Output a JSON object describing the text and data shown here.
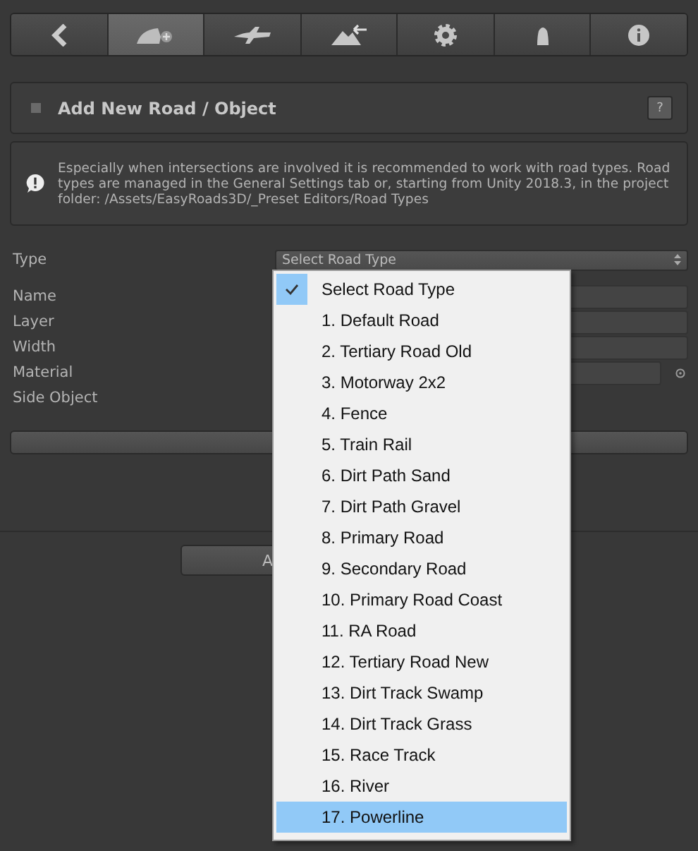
{
  "toolbar": {
    "tabs": [
      {
        "selected": false
      },
      {
        "selected": true
      },
      {
        "selected": false
      },
      {
        "selected": false
      },
      {
        "selected": false
      },
      {
        "selected": false
      },
      {
        "selected": false
      }
    ]
  },
  "section": {
    "title": "Add New Road / Object",
    "help": "?"
  },
  "info": {
    "text": "Especially when intersections are involved it is recommended to work with road types. Road types are managed in the General Settings tab or, starting from Unity 2018.3, in the project folder: /Assets/EasyRoads3D/_Preset Editors/Road Types"
  },
  "type": {
    "label": "Type",
    "value": "Select Road Type"
  },
  "fields": [
    {
      "label": "Name",
      "kind": "input"
    },
    {
      "label": "Layer",
      "kind": "input"
    },
    {
      "label": "Width",
      "kind": "input"
    },
    {
      "label": "Material",
      "kind": "object"
    },
    {
      "label": "Side Object",
      "kind": "none"
    }
  ],
  "add_button": {
    "label": "A"
  },
  "dropdown": {
    "items": [
      {
        "label": "Select Road Type",
        "checked": true,
        "highlighted": false
      },
      {
        "label": "1. Default Road",
        "checked": false,
        "highlighted": false
      },
      {
        "label": "2. Tertiary Road Old",
        "checked": false,
        "highlighted": false
      },
      {
        "label": "3. Motorway 2x2",
        "checked": false,
        "highlighted": false
      },
      {
        "label": "4. Fence",
        "checked": false,
        "highlighted": false
      },
      {
        "label": "5. Train Rail",
        "checked": false,
        "highlighted": false
      },
      {
        "label": "6. Dirt Path Sand",
        "checked": false,
        "highlighted": false
      },
      {
        "label": "7. Dirt Path Gravel",
        "checked": false,
        "highlighted": false
      },
      {
        "label": "8. Primary Road",
        "checked": false,
        "highlighted": false
      },
      {
        "label": "9. Secondary Road",
        "checked": false,
        "highlighted": false
      },
      {
        "label": "10. Primary Road Coast",
        "checked": false,
        "highlighted": false
      },
      {
        "label": "11. RA Road",
        "checked": false,
        "highlighted": false
      },
      {
        "label": "12. Tertiary Road New",
        "checked": false,
        "highlighted": false
      },
      {
        "label": "13. Dirt Track Swamp",
        "checked": false,
        "highlighted": false
      },
      {
        "label": "14. Dirt Track Grass",
        "checked": false,
        "highlighted": false
      },
      {
        "label": "15. Race Track",
        "checked": false,
        "highlighted": false
      },
      {
        "label": "16. River",
        "checked": false,
        "highlighted": false
      },
      {
        "label": "17. Powerline",
        "checked": false,
        "highlighted": true
      }
    ]
  }
}
